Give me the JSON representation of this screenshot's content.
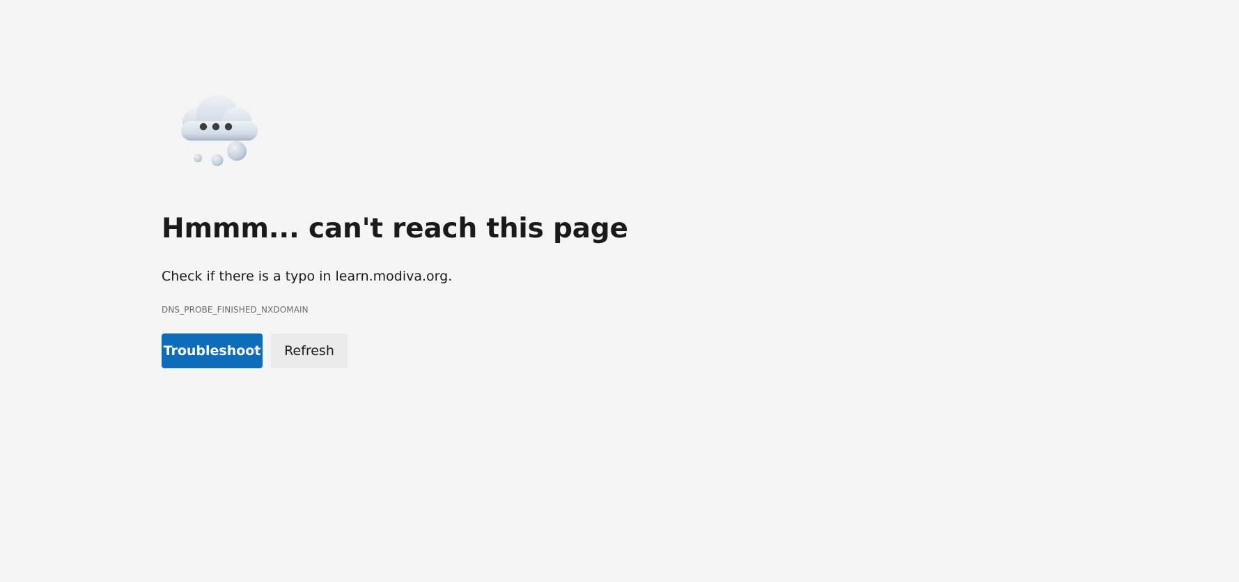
{
  "page": {
    "title": "Hmmm... can't reach this page",
    "subtitle": "Check if there is a typo in learn.modiva.org.",
    "error_code": "DNS_PROBE_FINISHED_NXDOMAIN"
  },
  "illustration": {
    "icon": "thinking-cloud-icon"
  },
  "buttons": {
    "troubleshoot_label": "Troubleshoot",
    "refresh_label": "Refresh"
  },
  "colors": {
    "background": "#f5f5f5",
    "primary_button": "#0f6cbd",
    "secondary_button": "#ebebeb",
    "error_code_text": "#6b6b6b"
  }
}
